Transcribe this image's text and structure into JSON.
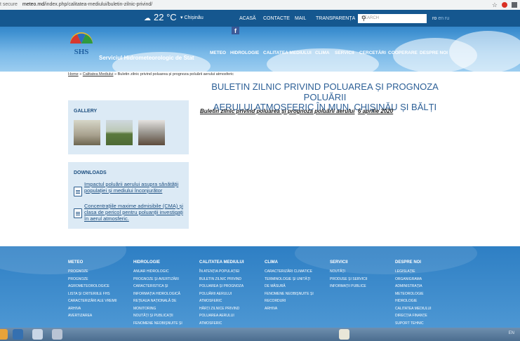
{
  "browser": {
    "security": "t secure",
    "url_host": "meteo.md",
    "url_path": "/index.php/calitatea-mediului/buletin-zilnic-privind/"
  },
  "header": {
    "temperature": "22 °C",
    "city": "Chișinău",
    "top_nav": [
      "ACASĂ",
      "CONTACTE",
      "MAIL",
      "TRANSPARENȚA"
    ],
    "search_placeholder": "SEARCH",
    "lang_active": "ro",
    "lang_other": "en ru",
    "site_name": "Serviciul Hidrometeorologic de Stat",
    "main_nav": [
      "METEO",
      "HIDROLOGIE",
      "CALITATEA MEDIULUI",
      "CLIMA",
      "SERVICII",
      "CERCETĂRI",
      "COOPERARE",
      "DESPRE NOI"
    ]
  },
  "breadcrumb": {
    "home": "Home",
    "section": "Calitatea Mediului",
    "current": "Buletin zilnic privind poluarea și prognoza poluării aerului atmosferic"
  },
  "page": {
    "title_line1": "BULETIN ZILNIC PRIVIND POLUAREA ȘI PROGNOZA POLUĂRII",
    "title_line2": "AERULUI ATMOSFERIC ÎN MUN. CHIȘINĂU ȘI BĂLȚI",
    "bulletin_link": "Buletin zilnic privind poluarea și prognoza poluării aerului",
    "bulletin_date": "6 aprilie 2020"
  },
  "sidebar": {
    "gallery_title": "GALLERY",
    "downloads_title": "DOWNLOADS",
    "downloads": [
      "Impactul poluării aerului asupra sănătății populației și mediului înconjurător",
      "Concentrațiile maxime admisibile (CMA) și clasa de pericol pentru poluanții investigați în aerul atmosferic."
    ]
  },
  "footer": {
    "columns": [
      {
        "title": "METEO",
        "items": [
          "PROGNOZE",
          "PROGNOZE",
          "AGROMETEOROLOGICE",
          "LISTA ȘI CRITERIILE FHS",
          "CARACTERIZĂRI ALE VREMII",
          "ARHIVA",
          "AVERTIZAREA"
        ]
      },
      {
        "title": "HIDROLOGIE",
        "items": [
          "ANUAR HIDROLOGIC",
          "PROGNOZE ȘI AVERTIZĂRI",
          "CARACTERISTICA ȘI",
          "INFORMAȚIA HIDROLOGICĂ",
          "REȚEAUA NAȚIONALĂ DE",
          "MONITORING",
          "NOUTĂȚI ȘI PUBLICAȚII",
          "FENOMENE NEOBIȘNUITE ȘI"
        ]
      },
      {
        "title": "CALITATEA MEDIULUI",
        "items": [
          "ÎN ATENȚIA POPULAȚIEI",
          "BULETIN ZILNIC PRIVIND",
          "POLUAREA ȘI PROGNOZA",
          "POLUĂRII AERULUI",
          "ATMOSFERIC",
          "HĂRȚI ZILNICE PRIVIND",
          "POLUAREA AERULUI",
          "ATMOSFERIC"
        ]
      },
      {
        "title": "CLIMA",
        "items": [
          "CARACTERIZĂRI CLIMATICE",
          "TERMINOLOGIE ȘI UNITĂȚI",
          "DE MĂSURĂ",
          "FENOMENE NEOBIȘNUITE ȘI",
          "RECORDURI",
          "ARHIVA"
        ]
      },
      {
        "title": "SERVICII",
        "items": [
          "NOUTĂȚI",
          "PRODUSE ȘI SERVICII",
          "INFORMAȚII PUBLICE"
        ]
      },
      {
        "title": "DESPRE NOI",
        "items": [
          "LEGISLAȚIE",
          "ORGANIGRAMA",
          "ADMINISTRAȚIA",
          "METEOROLOGIE",
          "HIDROLOGIE",
          "CALITATEA MEDIULUI",
          "DIRECȚIA FINANȚE",
          "SUPORT TEHNIC"
        ]
      }
    ]
  },
  "taskbar": {
    "tray_lang": "EN"
  }
}
